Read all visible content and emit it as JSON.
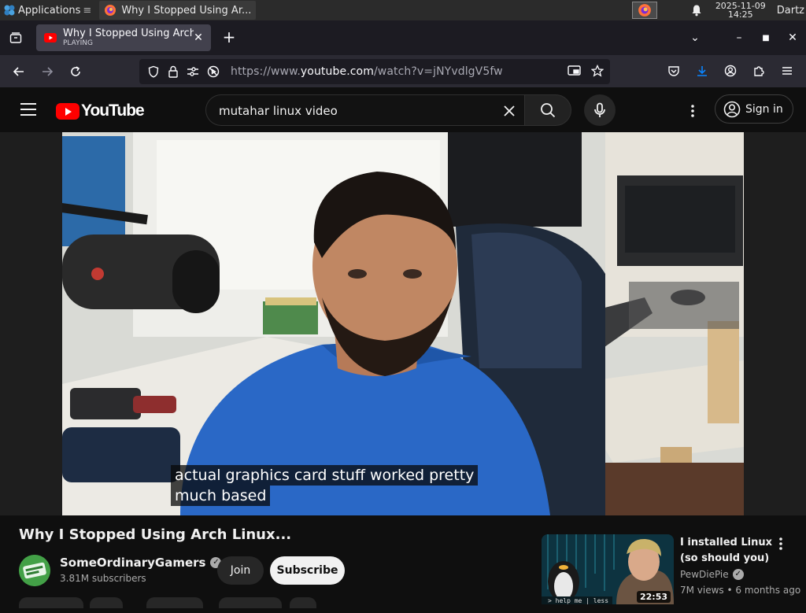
{
  "taskbar": {
    "apps_label": "Applications",
    "task_title": "Why I Stopped Using Ar...",
    "clock_date": "2025-11-09",
    "clock_time": "14:25",
    "user": "Dartz"
  },
  "browser": {
    "tab": {
      "title": "Why I Stopped Using Arch",
      "status": "PLAYING"
    },
    "url": {
      "prefix": "https://www.",
      "host": "youtube.com",
      "path": "/watch?v=jNYvdlgV5fw"
    }
  },
  "youtube": {
    "logo_text": "YouTube",
    "search": {
      "value": "mutahar linux video"
    },
    "signin_label": "Sign in",
    "captions": [
      "actual graphics card stuff worked pretty",
      "much based"
    ],
    "video": {
      "title": "Why I Stopped Using Arch Linux...",
      "channel": "SomeOrdinaryGamers",
      "subscribers": "3.81M subscribers",
      "join_label": "Join",
      "subscribe_label": "Subscribe"
    },
    "recommendation": {
      "title": "I installed Linux (so should you)",
      "channel": "PewDiePie",
      "meta": "7M views • 6 months ago",
      "duration": "22:53",
      "thumb_text": "> help me | less"
    }
  },
  "colors": {
    "yt_red": "#ff0000",
    "background": "#0f0f0f",
    "subscribe_bg": "#f1f1f1"
  }
}
